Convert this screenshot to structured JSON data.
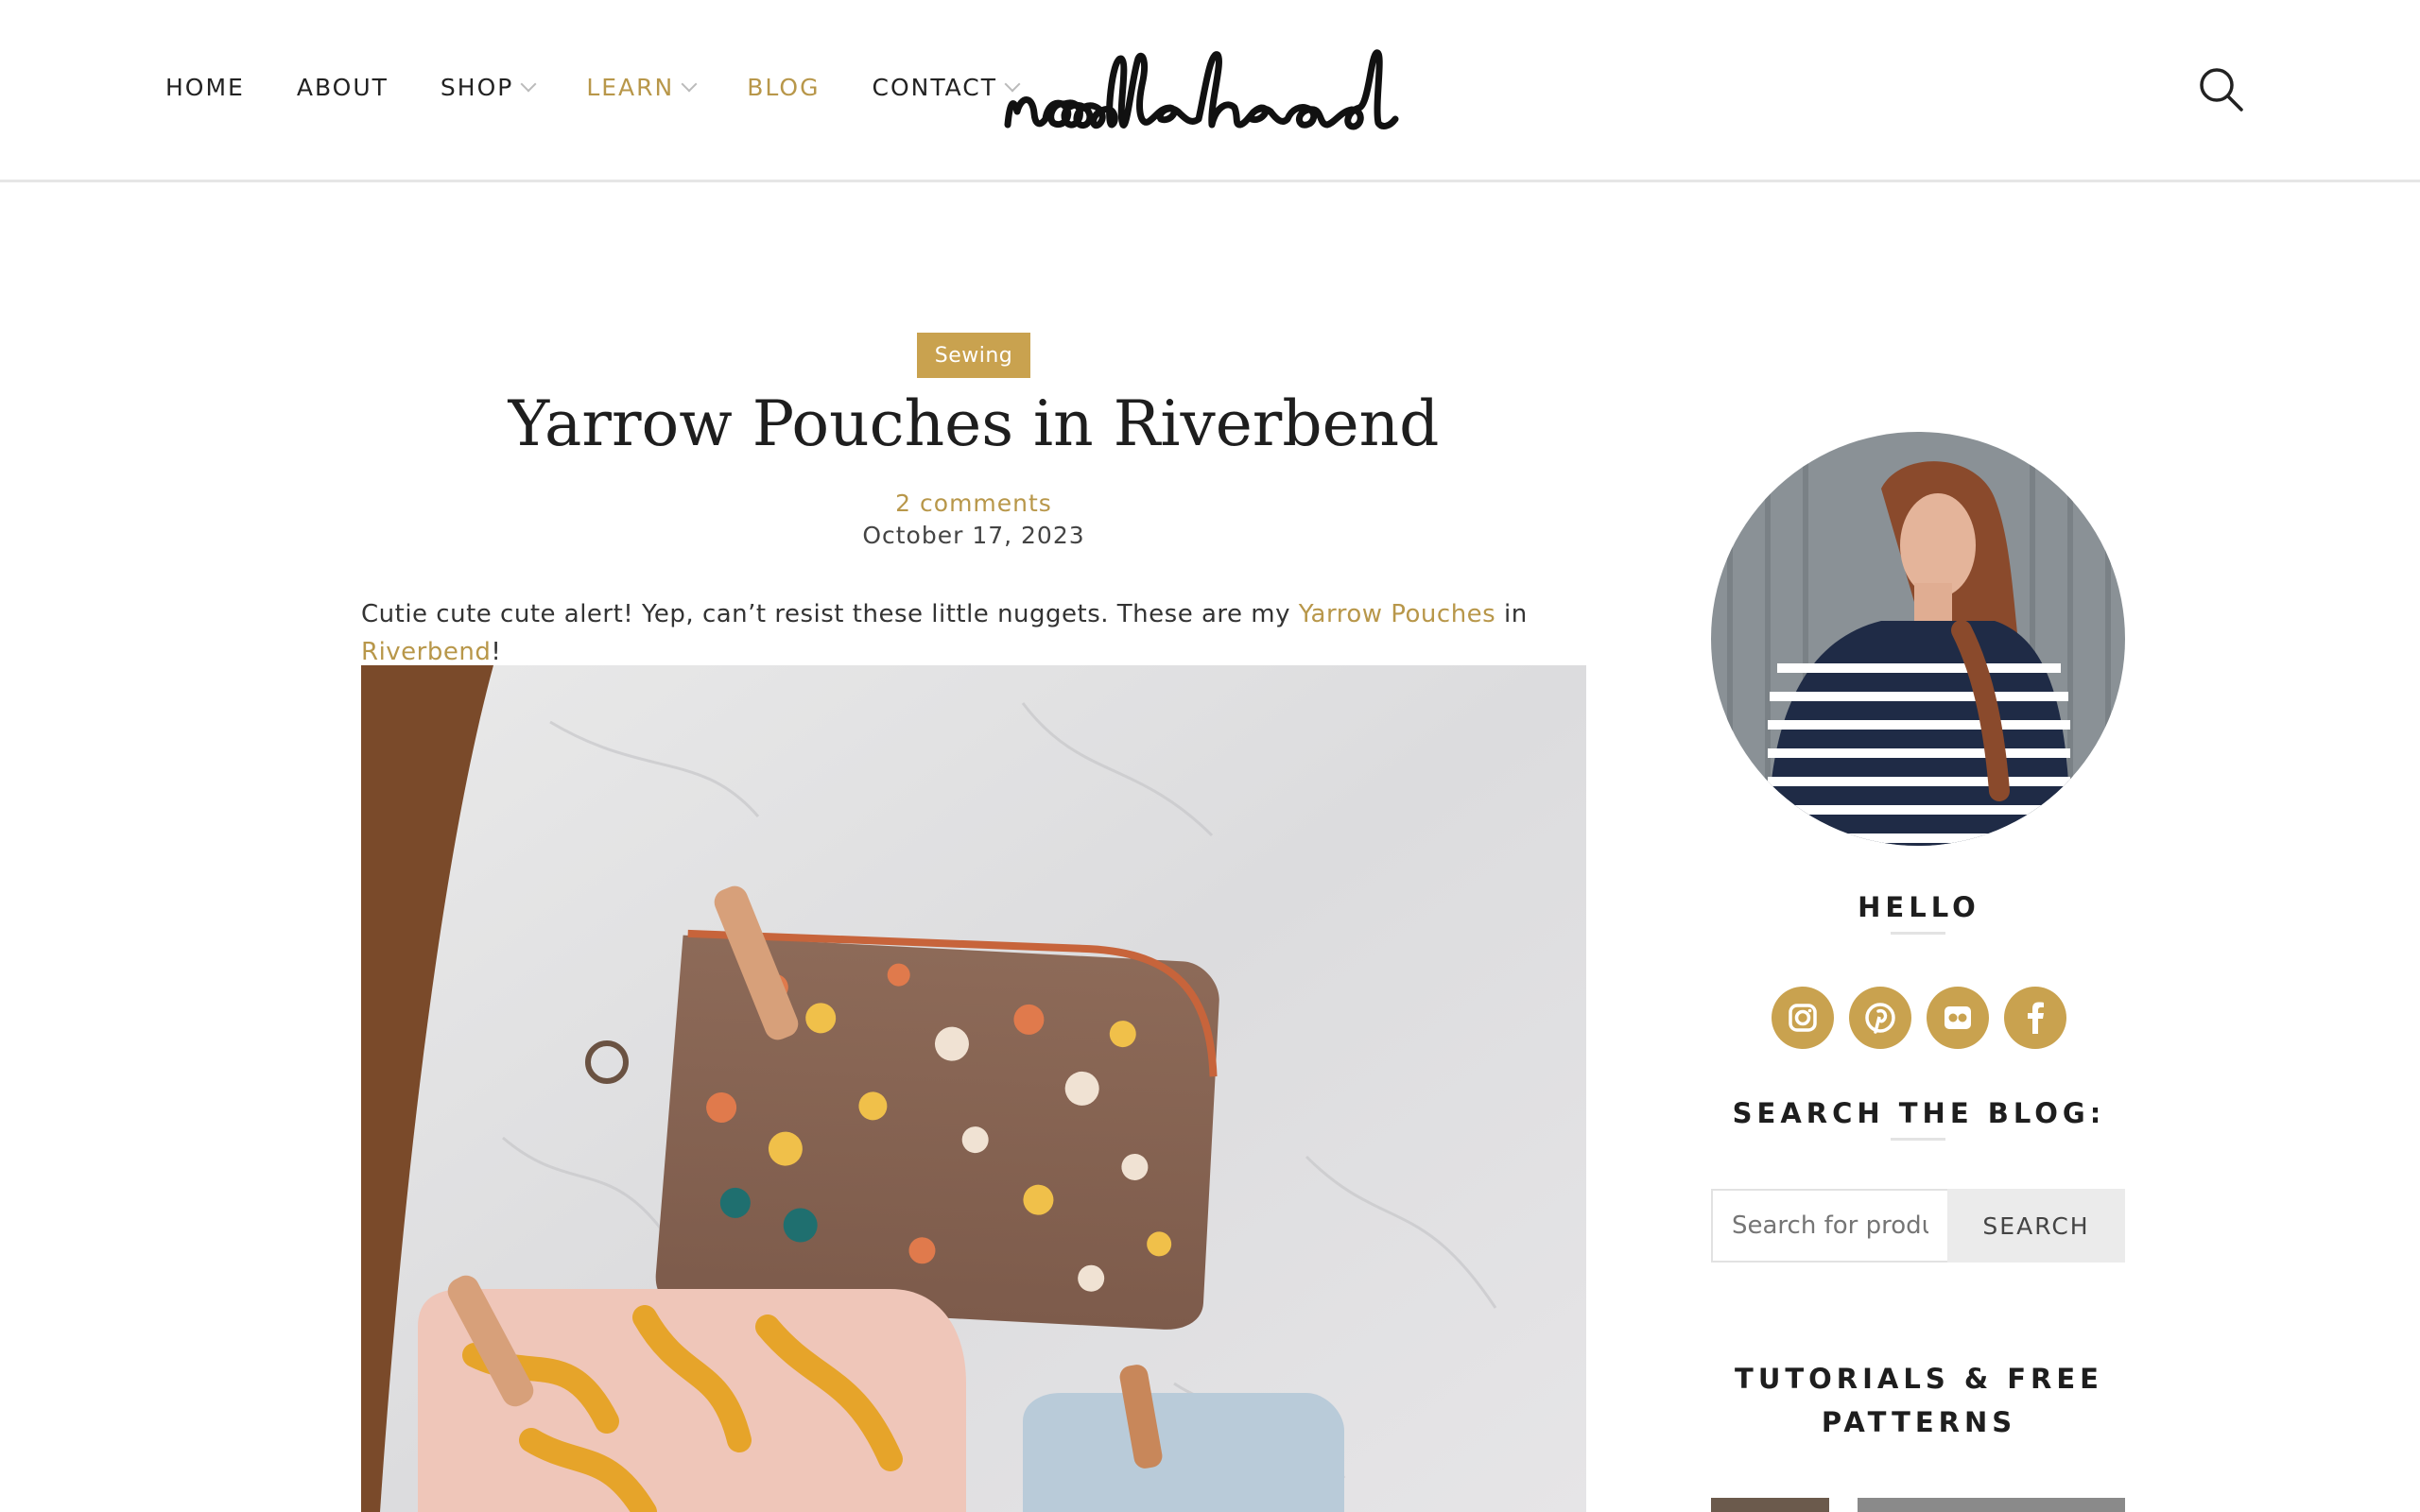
{
  "nav": {
    "items": [
      {
        "label": "HOME"
      },
      {
        "label": "ABOUT"
      },
      {
        "label": "SHOP"
      },
      {
        "label": "LEARN"
      },
      {
        "label": "BLOG"
      },
      {
        "label": "CONTACT"
      }
    ]
  },
  "brand": {
    "logo_text": "noodlehead",
    "accent_color": "#c9a24f",
    "link_color": "#b8974a"
  },
  "post": {
    "category": "Sewing",
    "title": "Yarrow Pouches in Riverbend",
    "comments": "2 comments",
    "date": "October 17, 2023",
    "intro_before": "Cutie cute cute alert! Yep, can’t resist these little nuggets. These are my ",
    "intro_link1": "Yarrow Pouches",
    "intro_mid": " in ",
    "intro_link2": "Riverbend",
    "intro_after": "!"
  },
  "sidebar": {
    "hello_title": "HELLO",
    "social_icons": [
      "instagram-icon",
      "pinterest-icon",
      "flickr-icon",
      "facebook-icon"
    ],
    "search_title": "SEARCH THE BLOG:",
    "search_placeholder": "Search for products",
    "search_button": "SEARCH",
    "tutorials_title_line1": "TUTORIALS & FREE",
    "tutorials_title_line2": "PATTERNS"
  }
}
